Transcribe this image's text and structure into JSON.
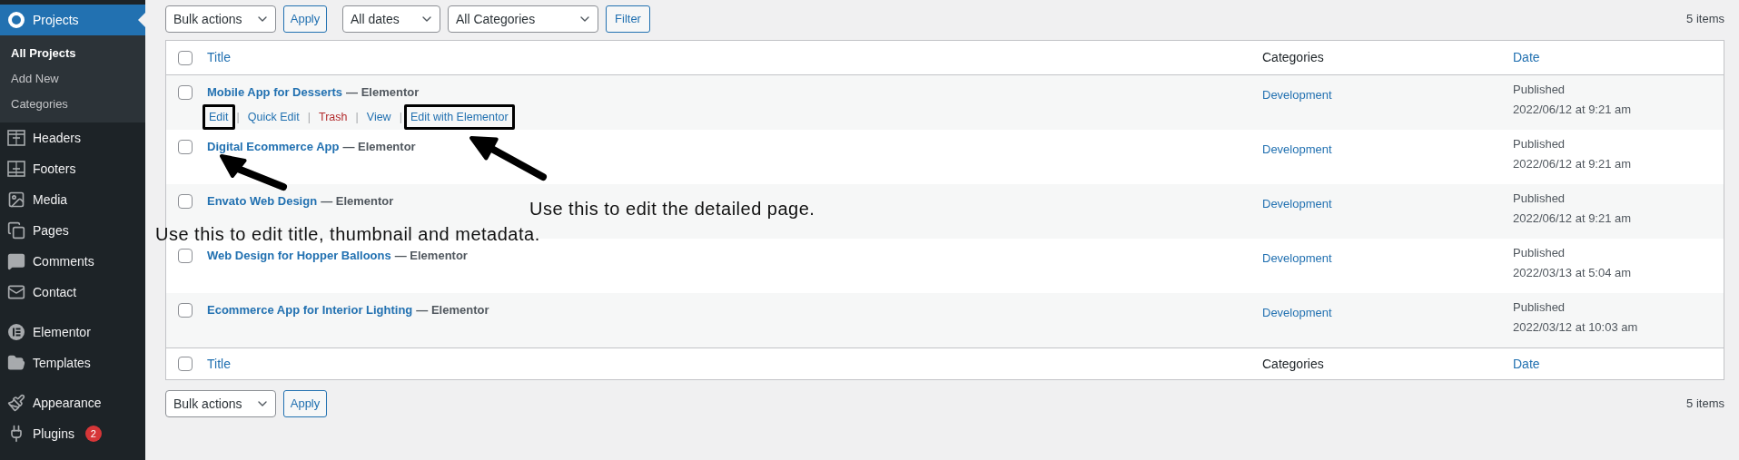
{
  "sidebar": {
    "groups": [
      [
        {
          "label": "Projects",
          "selected": true,
          "children": [
            {
              "label": "All Projects",
              "selected": true
            },
            {
              "label": "Add New",
              "selected": false
            },
            {
              "label": "Categories",
              "selected": false
            }
          ]
        },
        {
          "label": "Headers",
          "selected": false
        },
        {
          "label": "Footers",
          "selected": false
        },
        {
          "label": "Media",
          "selected": false
        },
        {
          "label": "Pages",
          "selected": false
        },
        {
          "label": "Comments",
          "selected": false
        },
        {
          "label": "Contact",
          "selected": false
        }
      ],
      [
        {
          "label": "Elementor",
          "selected": false
        },
        {
          "label": "Templates",
          "selected": false
        }
      ],
      [
        {
          "label": "Appearance",
          "selected": false
        },
        {
          "label": "Plugins",
          "selected": false,
          "badge": "2"
        }
      ]
    ]
  },
  "top_toolbar": {
    "bulk_actions": "Bulk actions",
    "apply": "Apply",
    "dates": "All dates",
    "categories": "All Categories",
    "filter": "Filter",
    "count": "5 items"
  },
  "table": {
    "header_checkbox": {
      "checked": false
    },
    "columns": [
      {
        "label": "Title",
        "sortable": true
      },
      {
        "label": "Categories",
        "sortable": false
      },
      {
        "label": "Date",
        "sortable": true
      }
    ],
    "rows": [
      {
        "title": "Mobile App for Desserts",
        "suffix": "— Elementor",
        "checked": false,
        "category": "Development",
        "status": "Published",
        "date": "2022/06/12 at 9:21 am",
        "row_actions": {
          "separator": "|",
          "links": [
            {
              "label": "Edit",
              "kind": "link",
              "highlighted": true
            },
            {
              "label": "Quick Edit",
              "kind": "link",
              "highlighted": false
            },
            {
              "label": "Trash",
              "kind": "trash",
              "highlighted": false
            },
            {
              "label": "View",
              "kind": "link",
              "highlighted": false
            },
            {
              "label": "Edit with Elementor",
              "kind": "link",
              "highlighted": true
            }
          ]
        }
      },
      {
        "title": "Digital Ecommerce App",
        "suffix": "— Elementor",
        "checked": false,
        "category": "Development",
        "status": "Published",
        "date": "2022/06/12 at 9:21 am"
      },
      {
        "title": "Envato Web Design",
        "suffix": "— Elementor",
        "checked": false,
        "category": "Development",
        "status": "Published",
        "date": "2022/06/12 at 9:21 am"
      },
      {
        "title": "Web Design for Hopper Balloons",
        "suffix": "— Elementor",
        "checked": false,
        "category": "Development",
        "status": "Published",
        "date": "2022/03/13 at 5:04 am"
      },
      {
        "title": "Ecommerce App for Interior Lighting",
        "suffix": "— Elementor",
        "checked": false,
        "category": "Development",
        "status": "Published",
        "date": "2022/03/12 at 10:03 am"
      }
    ],
    "footer_checkbox": {
      "checked": false
    },
    "footer_columns": [
      {
        "label": "Title",
        "sortable": true
      },
      {
        "label": "Categories",
        "sortable": false
      },
      {
        "label": "Date",
        "sortable": true
      }
    ]
  },
  "bottom_toolbar": {
    "bulk_actions": "Bulk actions",
    "apply": "Apply",
    "count": "5 items"
  },
  "annotations": [
    {
      "text": "Use this to edit the detailed page."
    },
    {
      "text": "Use this to edit title, thumbnail and metadata."
    }
  ]
}
